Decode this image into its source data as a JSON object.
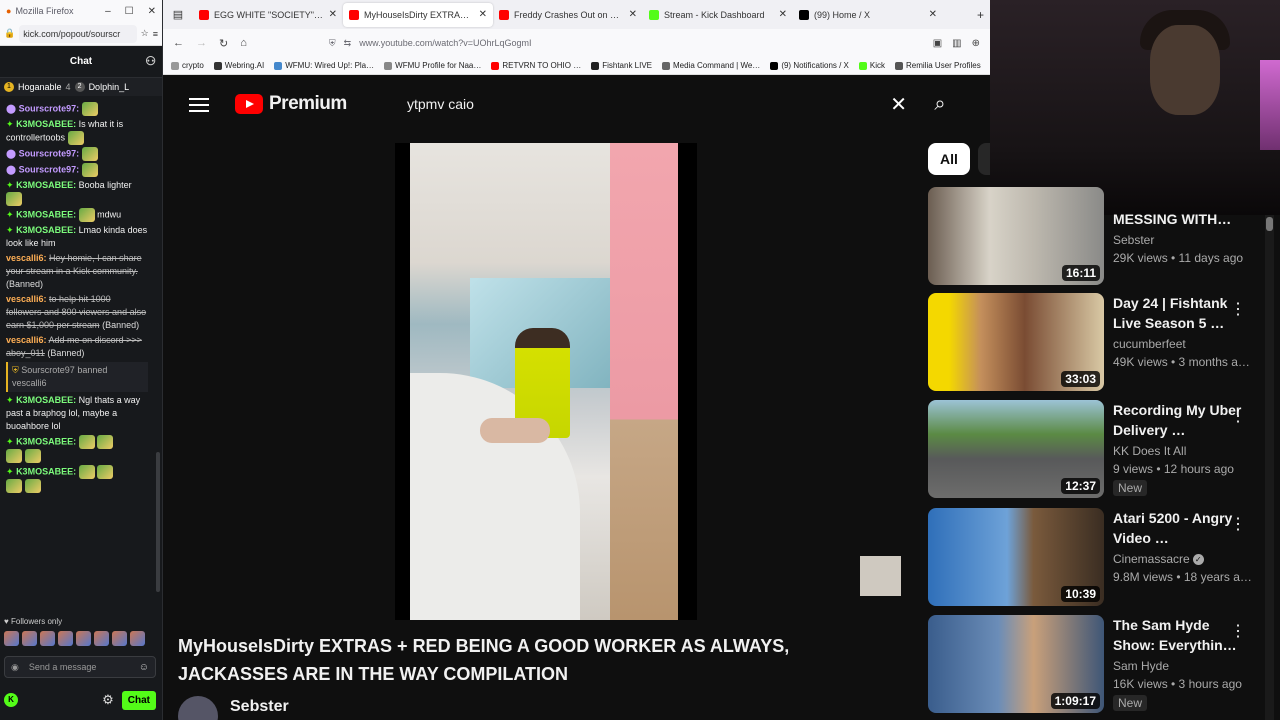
{
  "kick": {
    "window_title": "Mozilla Firefox",
    "url": "kick.com/popout/sourscr",
    "chat_title": "Chat",
    "pinned": [
      {
        "name": "Hoganable",
        "count": "4"
      },
      {
        "name": "Dolphin_L",
        "count": ""
      }
    ],
    "messages": [
      {
        "user": "Sourscrote97:",
        "text": "",
        "color": "purple"
      },
      {
        "user": "K3MOSABEE:",
        "text": "Is what it is controllertoobs",
        "color": "green"
      },
      {
        "user": "Sourscrote97:",
        "text": "",
        "color": "purple"
      },
      {
        "user": "Sourscrote97:",
        "text": "",
        "color": "purple"
      },
      {
        "user": "K3MOSABEE:",
        "text": "Booba lighter",
        "color": "green"
      },
      {
        "user": "K3MOSABEE:",
        "text": "mdwu",
        "color": "green"
      },
      {
        "user": "K3MOSABEE:",
        "text": "Lmao kinda does look like him",
        "color": "green"
      },
      {
        "user": "vescalli6:",
        "text": "Hey homie, I can share your stream in a Kick community.",
        "color": "orange",
        "banned_tag": "(Banned)"
      },
      {
        "user": "vescalli6:",
        "text": "to help hit 1000 followers and 800 viewers and also earn $1,000 per stream",
        "color": "orange",
        "banned_tag": "(Banned)"
      },
      {
        "user": "vescalli6:",
        "text": "Add me on discord >>> aboy_011",
        "color": "orange",
        "banned_tag": "(Banned)"
      }
    ],
    "system_message": {
      "user": "Sourscrote97",
      "action": "banned",
      "target": "vescalli6"
    },
    "messages2": [
      {
        "user": "K3MOSABEE:",
        "text": "Ngl thats a way past a braphog lol, maybe a buoahbore lol",
        "color": "green"
      },
      {
        "user": "K3MOSABEE:",
        "text": "",
        "color": "green"
      },
      {
        "user": "K3MOSABEE:",
        "text": "",
        "color": "green"
      }
    ],
    "followers_only": "Followers only",
    "send_placeholder": "Send a message",
    "chat_button": "Chat"
  },
  "browser": {
    "tabs": [
      {
        "title": "EGG WHITE \"SOCIETY\" (PROD…",
        "color": "#ff0000",
        "active": false
      },
      {
        "title": "MyHouseIsDirty EXTRAS + …",
        "color": "#ff0000",
        "active": true
      },
      {
        "title": "Freddy Crashes Out on BURT's C…",
        "color": "#ff0000",
        "active": false
      },
      {
        "title": "Stream - Kick Dashboard",
        "color": "#53fc18",
        "active": false
      },
      {
        "title": "(99) Home / X",
        "color": "#000000",
        "active": false
      }
    ],
    "url": "www.youtube.com/watch?v=UOhrLqGogmI",
    "bookmarks": [
      "crypto",
      "Webring.AI",
      "WFMU: Wired Up!: Pla…",
      "WFMU Profile for Naa…",
      "RETVRN TO OHIO …",
      "Fishtank LIVE",
      "Media Command | We…",
      "(9) Notifications / X",
      "Kick",
      "Remilia User Profiles"
    ]
  },
  "youtube": {
    "logo_text": "Premium",
    "search_value": "ytpmv caio",
    "video_title": "MyHouseIsDirty EXTRAS + RED BEING A GOOD WORKER AS ALWAYS, JACKASSES ARE IN THE WAY COMPILATION",
    "channel": "Sebster",
    "chip_all": "All",
    "recs": [
      {
        "title": "MESSING WITH…",
        "channel": "Sebster",
        "views": "29K views • 11 days ago",
        "duration": "16:11",
        "new": "",
        "verified": false
      },
      {
        "title": "Day 24 | Fishtank Live Season 5 …",
        "channel": "cucumberfeet",
        "views": "49K views • 3 months a…",
        "duration": "33:03",
        "new": "",
        "verified": false
      },
      {
        "title": "Recording My Uber Delivery …",
        "channel": "KK Does It All",
        "views": "9 views • 12 hours ago",
        "duration": "12:37",
        "new": "New",
        "verified": false
      },
      {
        "title": "Atari 5200 - Angry Video …",
        "channel": "Cinemassacre",
        "views": "9.8M views • 18 years a…",
        "duration": "10:39",
        "new": "",
        "verified": true
      },
      {
        "title": "The Sam Hyde Show: Everythin…",
        "channel": "Sam Hyde",
        "views": "16K views • 3 hours ago",
        "duration": "1:09:17",
        "new": "New",
        "verified": false
      }
    ]
  }
}
